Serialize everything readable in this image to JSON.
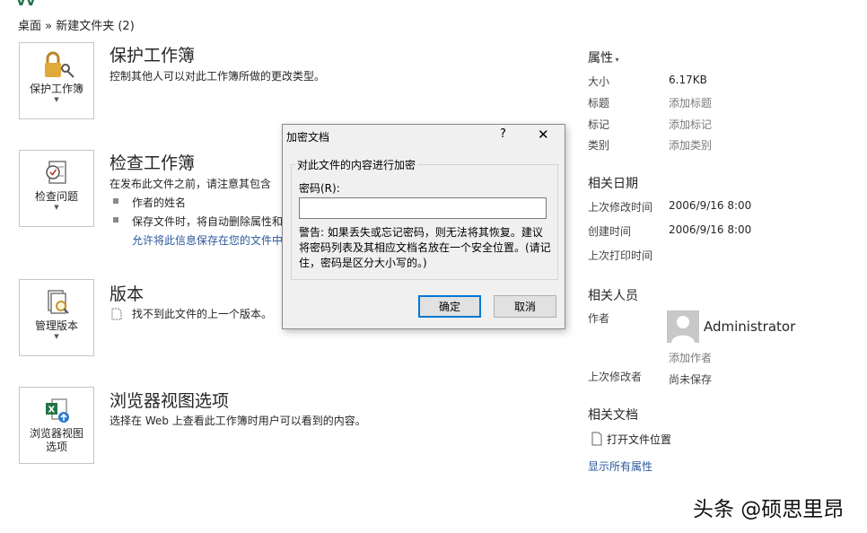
{
  "top_mark": "VV",
  "breadcrumb": "桌面 » 新建文件夹 (2)",
  "sections": {
    "protect": {
      "button_label": "保护工作簿",
      "title": "保护工作簿",
      "desc": "控制其他人可以对此工作簿所做的更改类型。"
    },
    "inspect": {
      "button_label": "检查问题",
      "title": "检查工作簿",
      "desc": "在发布此文件之前，请注意其包含",
      "bullets": [
        "作者的姓名",
        "保存文件时，将自动删除属性和"
      ],
      "link": "允许将此信息保存在您的文件中"
    },
    "versions": {
      "button_label": "管理版本",
      "title": "版本",
      "desc": "找不到此文件的上一个版本。"
    },
    "browser": {
      "button_label_line1": "浏览器视图",
      "button_label_line2": "选项",
      "title": "浏览器视图选项",
      "desc": "选择在 Web 上查看此工作簿时用户可以看到的内容。"
    }
  },
  "right_panel": {
    "properties_heading": "属性",
    "props": [
      {
        "label": "大小",
        "value": "6.17KB"
      },
      {
        "label": "标题",
        "value": "添加标题"
      },
      {
        "label": "标记",
        "value": "添加标记"
      },
      {
        "label": "类别",
        "value": "添加类别"
      }
    ],
    "dates_heading": "相关日期",
    "dates": [
      {
        "label": "上次修改时间",
        "value": "2006/9/16 8:00"
      },
      {
        "label": "创建时间",
        "value": "2006/9/16 8:00"
      },
      {
        "label": "上次打印时间",
        "value": ""
      }
    ],
    "people_heading": "相关人员",
    "author_label": "作者",
    "author_name": "Administrator",
    "add_author": "添加作者",
    "last_modified_by_label": "上次修改者",
    "last_modified_by_value": "尚未保存",
    "related_docs_heading": "相关文档",
    "open_location": "打开文件位置",
    "show_all": "显示所有属性"
  },
  "dialog": {
    "title": "加密文档",
    "help": "?",
    "close": "✕",
    "group_label": "对此文件的内容进行加密",
    "password_label": "密码(R):",
    "password_value": "",
    "warning": "警告: 如果丢失或忘记密码，则无法将其恢复。建议将密码列表及其相应文档名放在一个安全位置。(请记住，密码是区分大小写的。)",
    "ok": "确定",
    "cancel": "取消"
  },
  "watermark": "头条 @硕思里昂",
  "colors": {
    "link": "#2b579a",
    "accent_excel": "#217346",
    "focus_border": "#0078d7"
  }
}
